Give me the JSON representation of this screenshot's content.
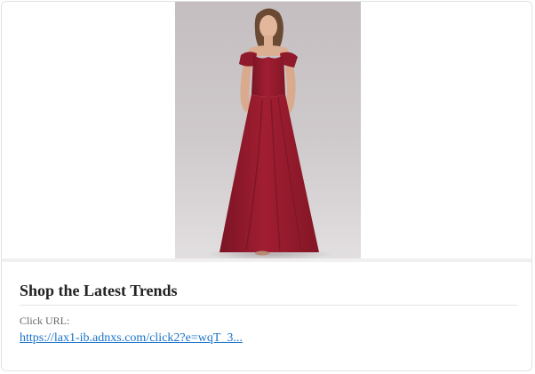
{
  "ad": {
    "headline": "Shop the Latest Trends",
    "click_url_label": "Click URL:",
    "click_url": "https://lax1-ib.adnxs.com/click2?e=wqT_3..."
  },
  "image": {
    "subject": "model in burgundy cold-shoulder maxi dress",
    "dress_color": "#9b1c2e",
    "background_color": "#c9c4c6"
  }
}
